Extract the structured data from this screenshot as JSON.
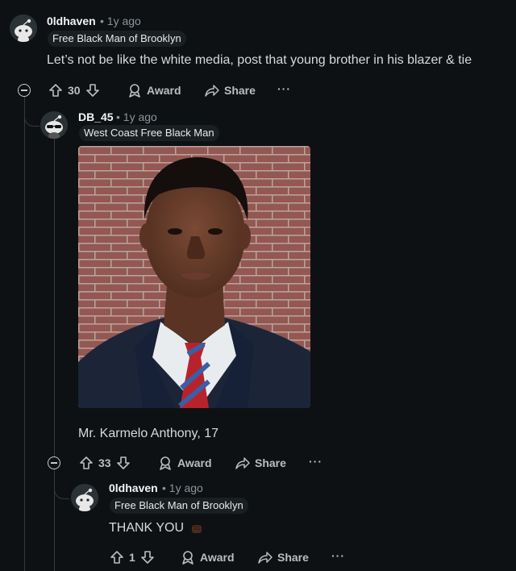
{
  "comments": [
    {
      "username": "0ldhaven",
      "separator": "•",
      "time": "1y ago",
      "flair": "Free Black Man of Brooklyn",
      "text": "Let’s not be like the white media, post that young brother in his blazer & tie",
      "votes": "30",
      "award_label": "Award",
      "share_label": "Share",
      "more_label": "···"
    },
    {
      "username": "DB_45",
      "separator": "•",
      "time": "1y ago",
      "flair": "West Coast Free Black Man",
      "image_alt": "Portrait of a young man in a navy blazer, white shirt and red-blue striped tie in front of a brick wall",
      "text": "Mr. Karmelo Anthony, 17",
      "votes": "33",
      "award_label": "Award",
      "share_label": "Share",
      "more_label": "···"
    },
    {
      "username": "0ldhaven",
      "separator": "•",
      "time": "1y ago",
      "flair": "Free Black Man of Brooklyn",
      "text": "THANK YOU",
      "emoji": "fist-icon",
      "votes": "1",
      "award_label": "Award",
      "share_label": "Share",
      "more_label": "···"
    }
  ],
  "colors": {
    "background": "#0e1113",
    "text": "#d7dadc",
    "muted": "#8a9499",
    "flair_bg": "#1a1f21"
  }
}
